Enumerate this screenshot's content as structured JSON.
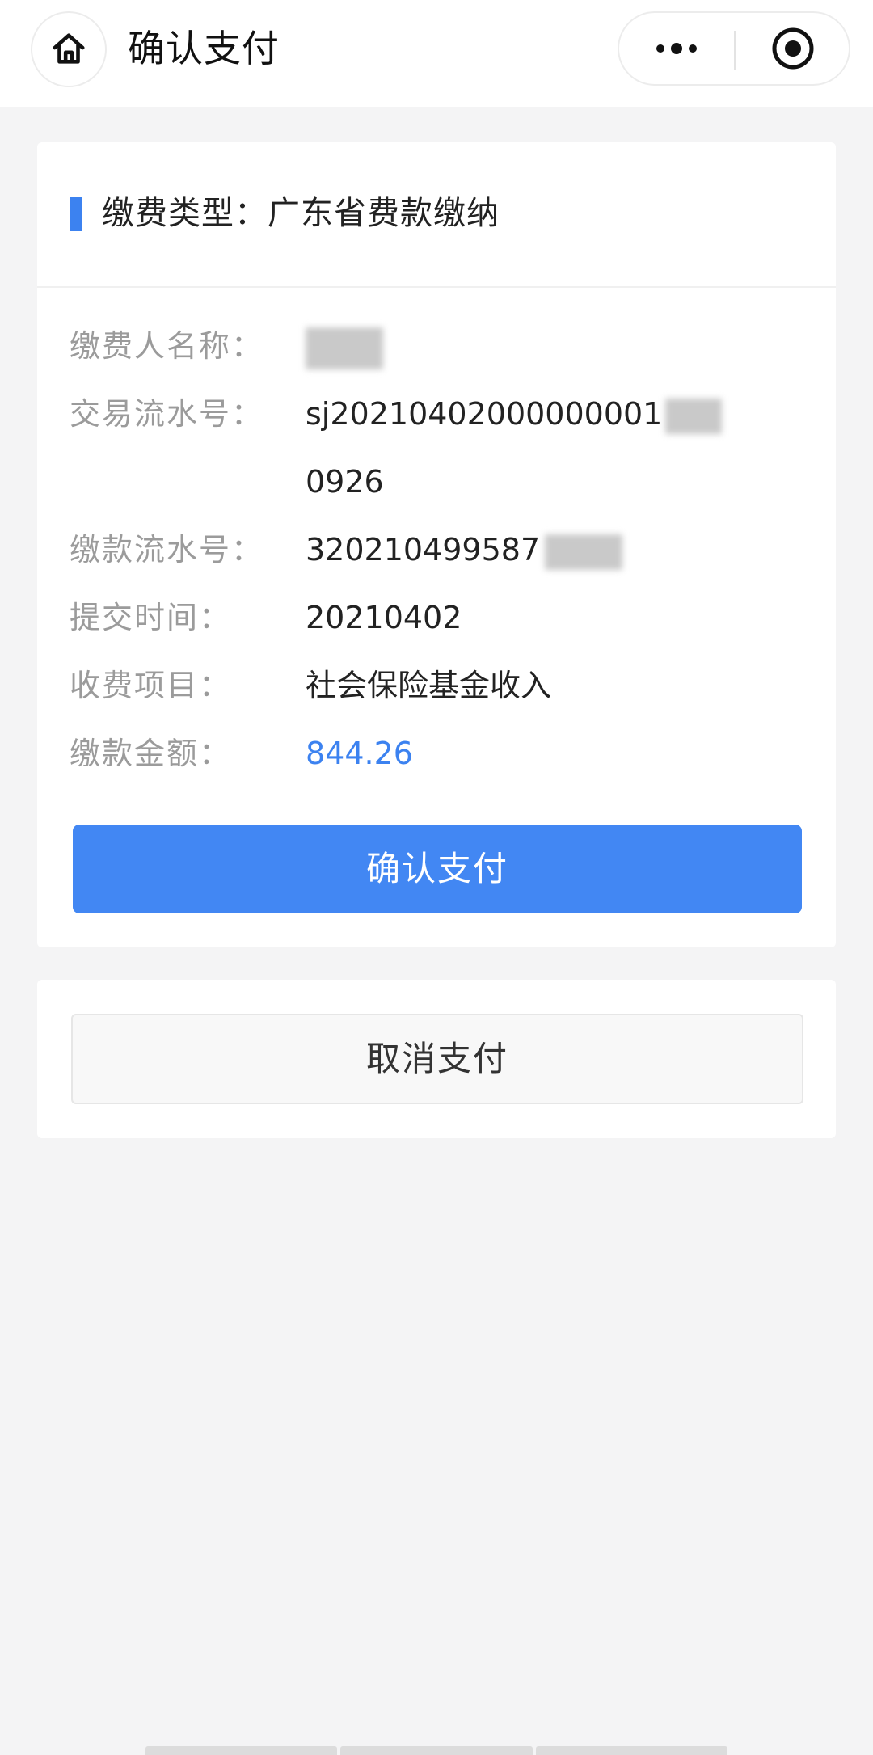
{
  "navbar": {
    "title": "确认支付",
    "home_icon": "home-icon",
    "more_icon": "more-dots-icon",
    "close_icon": "target-circle-icon"
  },
  "payment": {
    "type_label": "缴费类型：广东省费款缴纳",
    "rows": [
      {
        "label": "缴费人名称：",
        "value": ""
      },
      {
        "label": "交易流水号：",
        "value": "sj20210402000000001",
        "value_line2": "0926"
      },
      {
        "label": "缴款流水号：",
        "value": "320210499587"
      },
      {
        "label": "提交时间：",
        "value": "20210402"
      },
      {
        "label": "收费项目：",
        "value": "社会保险基金收入"
      },
      {
        "label": "缴款金额：",
        "value": "844.26"
      }
    ],
    "confirm_label": "确认支付",
    "cancel_label": "取消支付"
  },
  "colors": {
    "accent": "#4287f3",
    "amount": "#3c82f0",
    "background": "#f4f4f5"
  }
}
